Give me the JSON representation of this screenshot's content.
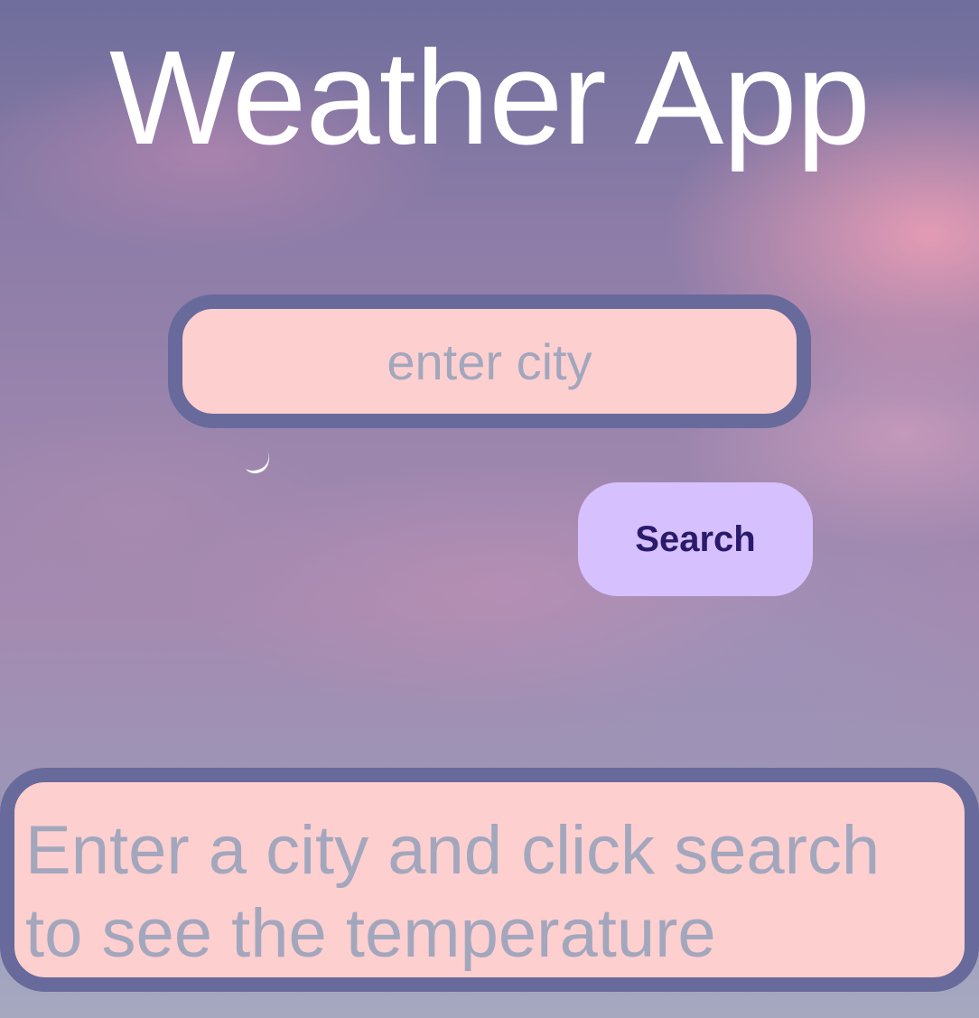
{
  "app": {
    "title": "Weather App"
  },
  "search": {
    "placeholder": "enter city",
    "value": "",
    "button_label": "Search"
  },
  "result": {
    "message": "Enter a city and click search to see the temperature"
  },
  "decor": {
    "icons": [
      "crescent-moon-icon"
    ]
  },
  "colors": {
    "title_text": "#ffffff",
    "field_background": "#fdcfcf",
    "field_border": "#686a9b",
    "muted_text": "#a3a7bd",
    "button_background": "#d6c0fd",
    "button_text": "#2a1a6b"
  }
}
